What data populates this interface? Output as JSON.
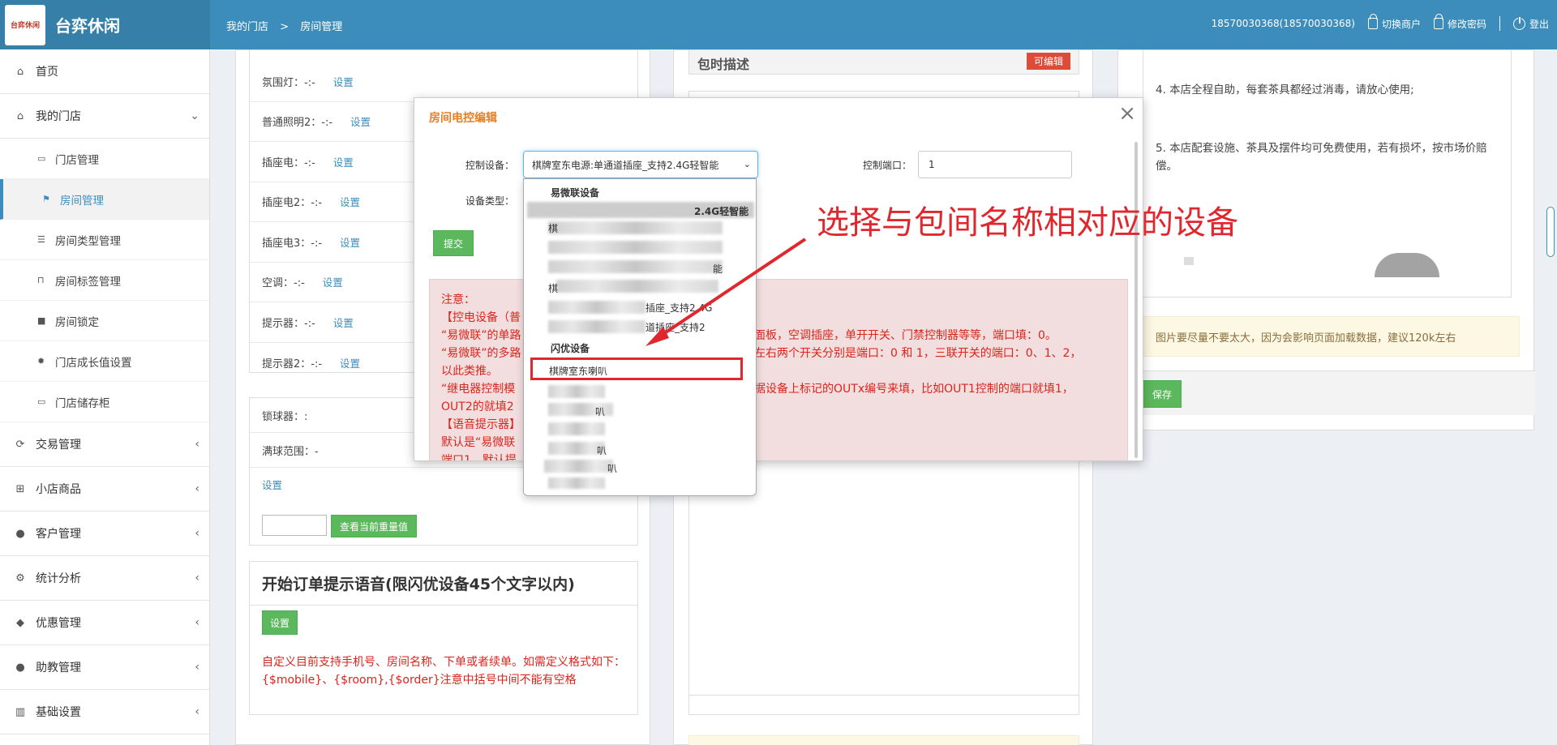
{
  "header": {
    "logo_mark": "台弈休闲",
    "brand": "台弈休闲",
    "breadcrumb": [
      "我的门店",
      ">",
      "房间管理"
    ],
    "account": "18570030368(18570030368)",
    "switch_merchant": "切换商户",
    "change_password": "修改密码",
    "logout": "登出"
  },
  "sidebar": {
    "items": [
      {
        "label": "首页",
        "icon": "home-icon"
      },
      {
        "label": "我的门店",
        "icon": "store-icon"
      },
      {
        "label": "交易管理",
        "icon": "refresh-icon"
      },
      {
        "label": "小店商品",
        "icon": "gift-icon"
      },
      {
        "label": "客户管理",
        "icon": "user-icon"
      },
      {
        "label": "统计分析",
        "icon": "gear-icon"
      },
      {
        "label": "优惠管理",
        "icon": "tags-icon"
      },
      {
        "label": "助教管理",
        "icon": "user-icon"
      },
      {
        "label": "基础设置",
        "icon": "barcode-icon"
      }
    ],
    "sub_items": [
      {
        "label": "门店管理"
      },
      {
        "label": "房间管理"
      },
      {
        "label": "房间类型管理"
      },
      {
        "label": "房间标签管理"
      },
      {
        "label": "房间锁定"
      },
      {
        "label": "门店成长值设置"
      },
      {
        "label": "门店储存柜"
      }
    ]
  },
  "devices": [
    {
      "label": "氛围灯：-:-",
      "action": "设置"
    },
    {
      "label": "普通照明2：-:-",
      "action": "设置"
    },
    {
      "label": "插座电：-:-",
      "action": "设置"
    },
    {
      "label": "插座电2：-:-",
      "action": "设置"
    },
    {
      "label": "插座电3：-:-",
      "action": "设置"
    },
    {
      "label": "空调：-:-",
      "action": "设置"
    },
    {
      "label": "提示器：-:-",
      "action": "设置"
    },
    {
      "label": "提示器2：-:-",
      "action": "设置"
    }
  ],
  "lock_box": {
    "lock_label": "锁球器：:",
    "range_label": "满球范围：-",
    "set_link": "设置",
    "query_button": "查看当前重量值"
  },
  "voice_box": {
    "title": "开始订单提示语音(限闪优设备45个文字以内)",
    "button": "设置",
    "note": "自定义目前支持手机号、房间名称、下单或者续单。如需定义格式如下：{$mobile}、{$room},{$order}注意中括号中间不能有空格"
  },
  "description": {
    "title": "包时描述",
    "badge": "可编辑"
  },
  "right_panel": {
    "p4": "4. 本店全程自助，每套茶具都经过消毒，请放心使用;",
    "p5": "5. 本店配套设施、茶具及摆件均可免费使用，若有损坏，按市场价赔偿。",
    "warning": "图片要尽量不要太大，因为会影响页面加载数据，建议120k左右",
    "save": "保存"
  },
  "modal": {
    "title": "房间电控编辑",
    "close": "×",
    "control_device_label": "控制设备：",
    "control_device_value": "棋牌室东电源:单通道插座_支持2.4G轻智能",
    "device_type_label": "设备类型：",
    "control_port_label": "控制端口：",
    "control_port_value": "1",
    "submit": "提交",
    "note_lines": [
      "注意：",
      "【控电设备（普",
      "“易微联”的单路",
      "“易微联”的多路",
      "以此类推。",
      "“继电器控制模",
      "OUT2的就填2",
      "【语音提示器】",
      "默认是“易微联",
      "端口1，默认提"
    ],
    "note_right": [
      "面板，空调插座，单开开关、门禁控制器等等，端口填：0。",
      "左右两个开关分别是端口：0 和 1，三联开关的端口：0、1、2，",
      "据设备上标记的OUTx编号来填，比如OUT1控制的端口就填1，"
    ]
  },
  "dropdown": {
    "group1": "易微联设备",
    "opt_partial1": "2.4G轻智能",
    "opt_partial2": "棋",
    "opt_partial3": "能",
    "opt_partial4": "棋",
    "opt_partial5": "插座_支持2.4G",
    "opt_partial6": "道插座_支持2",
    "group2": "闪优设备",
    "selected_option": "棋牌室东喇叭",
    "opt_partial7": "叭",
    "opt_partial8": "叭",
    "opt_partial9": "叭"
  },
  "annotation": "选择与包间名称相对应的设备",
  "colors": {
    "primary": "#3c8dbc",
    "danger": "#dd4b39",
    "success": "#5cb85c",
    "annotation": "#e0272d"
  }
}
